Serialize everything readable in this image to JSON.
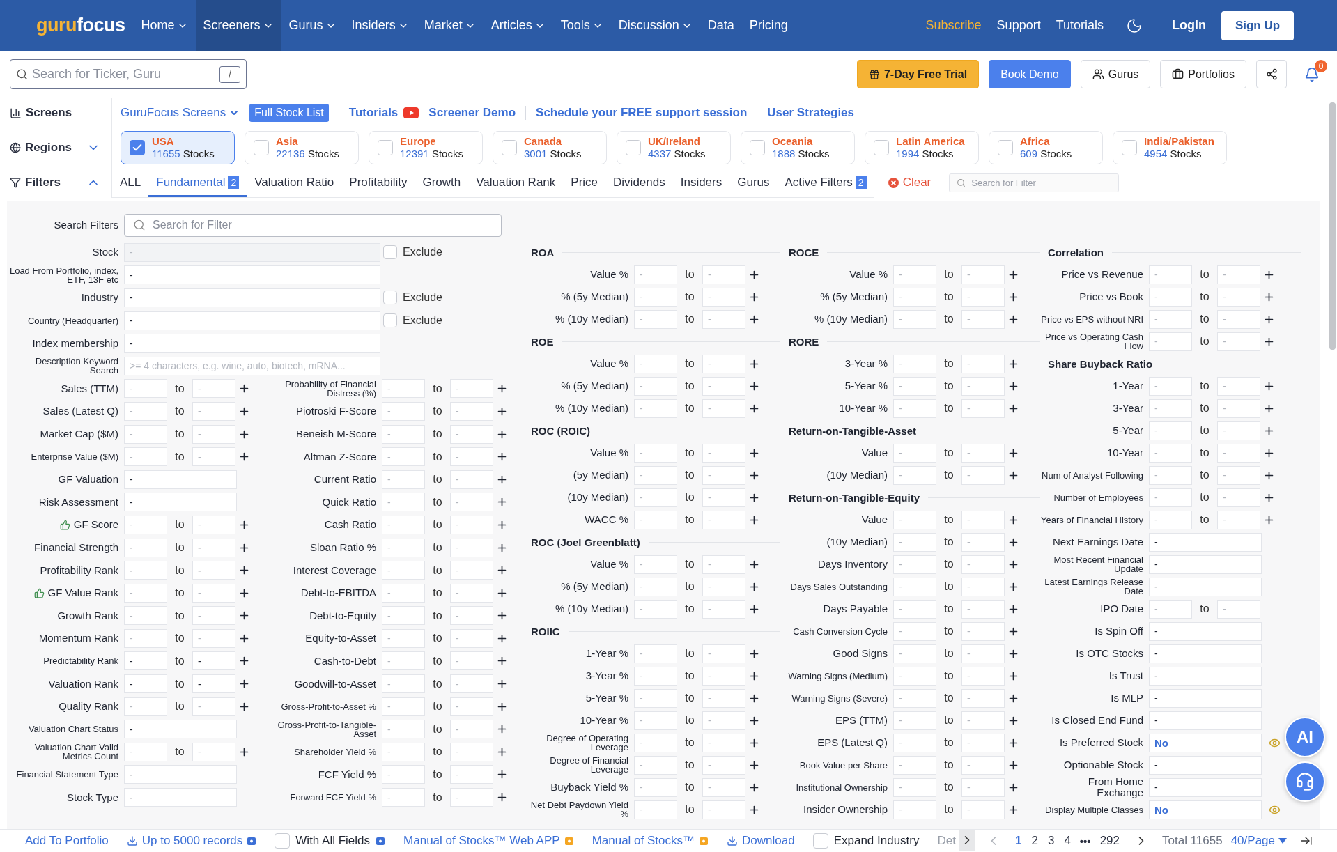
{
  "header": {
    "logo": {
      "first": "guru",
      "second": "focus"
    },
    "nav": [
      {
        "label": "Home",
        "has_menu": true,
        "selected": false
      },
      {
        "label": "Screeners",
        "has_menu": true,
        "selected": true
      },
      {
        "label": "Gurus",
        "has_menu": true,
        "selected": false
      },
      {
        "label": "Insiders",
        "has_menu": true,
        "selected": false
      },
      {
        "label": "Market",
        "has_menu": true,
        "selected": false
      },
      {
        "label": "Articles",
        "has_menu": true,
        "selected": false
      },
      {
        "label": "Tools",
        "has_menu": true,
        "selected": false
      },
      {
        "label": "Discussion",
        "has_menu": true,
        "selected": false
      },
      {
        "label": "Data",
        "has_menu": false,
        "selected": false
      },
      {
        "label": "Pricing",
        "has_menu": false,
        "selected": false
      }
    ],
    "links": [
      {
        "label": "Subscribe",
        "kind": "promo"
      },
      {
        "label": "Support",
        "kind": "plain"
      },
      {
        "label": "Tutorials",
        "kind": "plain"
      }
    ],
    "login": "Login",
    "signup": "Sign Up"
  },
  "toolbar": {
    "search": {
      "placeholder": "Search for Ticker, Guru",
      "shortcut": "/"
    },
    "buttons": [
      {
        "label": "7-Day Free Trial",
        "kind": "trial"
      },
      {
        "label": "Book Demo",
        "kind": "primary"
      },
      {
        "label": "Gurus",
        "kind": "gurus"
      },
      {
        "label": "Portfolios",
        "kind": "portfolios"
      }
    ],
    "notifications": "0"
  },
  "screens": {
    "label": "Screens",
    "dropdown": "GuruFocus Screens",
    "full_list": "Full Stock List",
    "links": [
      {
        "label": "Tutorials",
        "video": true,
        "divider_before": true
      },
      {
        "label": "Screener Demo",
        "video": false,
        "divider_before": false
      },
      {
        "label": "Schedule your FREE support session",
        "video": false,
        "divider_before": true
      },
      {
        "label": "User Strategies",
        "video": false,
        "divider_before": true
      }
    ]
  },
  "regions": {
    "label": "Regions",
    "expanded": false,
    "items": [
      {
        "name": "USA",
        "count": "11655",
        "unit": "Stocks",
        "selected": true
      },
      {
        "name": "Asia",
        "count": "22136",
        "unit": "Stocks",
        "selected": false
      },
      {
        "name": "Europe",
        "count": "12391",
        "unit": "Stocks",
        "selected": false
      },
      {
        "name": "Canada",
        "count": "3001",
        "unit": "Stocks",
        "selected": false
      },
      {
        "name": "UK/Ireland",
        "count": "4337",
        "unit": "Stocks",
        "selected": false
      },
      {
        "name": "Oceania",
        "count": "1888",
        "unit": "Stocks",
        "selected": false
      },
      {
        "name": "Latin America",
        "count": "1994",
        "unit": "Stocks",
        "selected": false
      },
      {
        "name": "Africa",
        "count": "609",
        "unit": "Stocks",
        "selected": false
      },
      {
        "name": "India/Pakistan",
        "count": "4954",
        "unit": "Stocks",
        "selected": false
      }
    ]
  },
  "filters": {
    "label": "Filters",
    "expanded": true,
    "tabs": [
      {
        "label": "ALL",
        "selected": false
      },
      {
        "label": "Fundamental",
        "selected": true,
        "count": "2"
      },
      {
        "label": "Valuation Ratio",
        "selected": false
      },
      {
        "label": "Profitability",
        "selected": false
      },
      {
        "label": "Growth",
        "selected": false
      },
      {
        "label": "Valuation Rank",
        "selected": false
      },
      {
        "label": "Price",
        "selected": false
      },
      {
        "label": "Dividends",
        "selected": false
      },
      {
        "label": "Insiders",
        "selected": false
      },
      {
        "label": "Gurus",
        "selected": false
      },
      {
        "label": "Active Filters",
        "selected": false,
        "count": "2"
      }
    ],
    "clear": "Clear",
    "search_placeholder": "Search for Filter"
  },
  "panel": {
    "search_label": "Search Filters",
    "search_placeholder": "Search for Filter",
    "top_rows": [
      {
        "label": "Stock",
        "placeholder": "-",
        "disabled": true,
        "exclude": "Exclude",
        "excluded": false
      },
      {
        "label": "Load From Portfolio, index, ETF, 13F etc",
        "value": "-",
        "disabled": false
      },
      {
        "label": "Industry",
        "value": "-",
        "disabled": false,
        "exclude": "Exclude",
        "excluded": false
      },
      {
        "label": "Country (Headquarter)",
        "value": "-",
        "disabled": false,
        "exclude": "Exclude",
        "excluded": false
      },
      {
        "label": "Index membership",
        "value": "-",
        "disabled": false
      },
      {
        "label": "Description Keyword Search",
        "placeholder": ">= 4 characters, e.g. wine, auto, biotech, mRNA...",
        "disabled": false
      }
    ],
    "left": [
      {
        "kind": "range",
        "label": "Sales (TTM)",
        "min": "-",
        "sep": "to",
        "max": "-"
      },
      {
        "kind": "range",
        "label": "Sales (Latest Q)",
        "min": "-",
        "sep": "to",
        "max": "-"
      },
      {
        "kind": "range",
        "label": "Market Cap ($M)",
        "min": "-",
        "sep": "to",
        "max": "-"
      },
      {
        "kind": "range",
        "label": "Enterprise Value ($M)",
        "min": "-",
        "sep": "to",
        "max": "-"
      },
      {
        "kind": "select",
        "label": "GF Valuation",
        "value": "-"
      },
      {
        "kind": "select",
        "label": "Risk Assessment",
        "value": "-"
      },
      {
        "kind": "range",
        "label": "GF Score",
        "min": "-",
        "sep": "to",
        "max": "-",
        "thumb": true
      },
      {
        "kind": "rank_range",
        "label": "Financial Strength",
        "min": "-",
        "sep": "to",
        "max": "-"
      },
      {
        "kind": "rank_range",
        "label": "Profitability Rank",
        "min": "-",
        "sep": "to",
        "max": "-"
      },
      {
        "kind": "range",
        "label": "GF Value Rank",
        "min": "-",
        "sep": "to",
        "max": "-",
        "thumb": true
      },
      {
        "kind": "range",
        "label": "Growth Rank",
        "min": "-",
        "sep": "to",
        "max": "-"
      },
      {
        "kind": "range",
        "label": "Momentum Rank",
        "min": "-",
        "sep": "to",
        "max": "-"
      },
      {
        "kind": "rank_range",
        "label": "Predictability Rank",
        "min": "-",
        "sep": "to",
        "max": "-"
      },
      {
        "kind": "rank_range",
        "label": "Valuation Rank",
        "min": "-",
        "sep": "to",
        "max": "-"
      },
      {
        "kind": "range",
        "label": "Quality Rank",
        "min": "-",
        "sep": "to",
        "max": "-"
      },
      {
        "kind": "select",
        "label": "Valuation Chart Status",
        "value": "-"
      },
      {
        "kind": "range",
        "label": "Valuation Chart Valid Metrics Count",
        "min": "-",
        "sep": "to",
        "max": "-"
      },
      {
        "kind": "select",
        "label": "Financial Statement Type",
        "value": "-"
      },
      {
        "kind": "select",
        "label": "Stock Type",
        "value": "-"
      }
    ],
    "right": [
      {
        "kind": "range",
        "label": "Probability of Financial Distress (%)",
        "min": "-",
        "sep": "to",
        "max": "-"
      },
      {
        "kind": "range",
        "label": "Piotroski F-Score",
        "min": "-",
        "sep": "to",
        "max": "-"
      },
      {
        "kind": "range",
        "label": "Beneish M-Score",
        "min": "-",
        "sep": "to",
        "max": "-"
      },
      {
        "kind": "range",
        "label": "Altman Z-Score",
        "min": "-",
        "sep": "to",
        "max": "-"
      },
      {
        "kind": "range",
        "label": "Current Ratio",
        "min": "-",
        "sep": "to",
        "max": "-"
      },
      {
        "kind": "range",
        "label": "Quick Ratio",
        "min": "-",
        "sep": "to",
        "max": "-"
      },
      {
        "kind": "range",
        "label": "Cash Ratio",
        "min": "-",
        "sep": "to",
        "max": "-"
      },
      {
        "kind": "range",
        "label": "Sloan Ratio %",
        "min": "-",
        "sep": "to",
        "max": "-"
      },
      {
        "kind": "range",
        "label": "Interest Coverage",
        "min": "-",
        "sep": "to",
        "max": "-"
      },
      {
        "kind": "range",
        "label": "Debt-to-EBITDA",
        "min": "-",
        "sep": "to",
        "max": "-"
      },
      {
        "kind": "range",
        "label": "Debt-to-Equity",
        "min": "-",
        "sep": "to",
        "max": "-"
      },
      {
        "kind": "range",
        "label": "Equity-to-Asset",
        "min": "-",
        "sep": "to",
        "max": "-"
      },
      {
        "kind": "range",
        "label": "Cash-to-Debt",
        "min": "-",
        "sep": "to",
        "max": "-"
      },
      {
        "kind": "range",
        "label": "Goodwill-to-Asset",
        "min": "-",
        "sep": "to",
        "max": "-"
      },
      {
        "kind": "range",
        "label": "Gross-Profit-to-Asset %",
        "min": "-",
        "sep": "to",
        "max": "-"
      },
      {
        "kind": "range",
        "label": "Gross-Profit-to-Tangible-Asset",
        "min": "-",
        "sep": "to",
        "max": "-"
      },
      {
        "kind": "range",
        "label": "Shareholder Yield %",
        "min": "-",
        "sep": "to",
        "max": "-"
      },
      {
        "kind": "range",
        "label": "FCF Yield %",
        "min": "-",
        "sep": "to",
        "max": "-"
      },
      {
        "kind": "range",
        "label": "Forward FCF Yield %",
        "min": "-",
        "sep": "to",
        "max": "-"
      }
    ],
    "columns": [
      [
        {
          "heading": "ROA",
          "rows": [
            {
              "kind": "range",
              "label": "Value %",
              "min": "-",
              "sep": "to",
              "max": "-"
            },
            {
              "kind": "range",
              "label": "% (5y Median)",
              "min": "-",
              "sep": "to",
              "max": "-"
            },
            {
              "kind": "range",
              "label": "% (10y Median)",
              "min": "-",
              "sep": "to",
              "max": "-"
            }
          ]
        },
        {
          "heading": "ROE",
          "rows": [
            {
              "kind": "range",
              "label": "Value %",
              "min": "-",
              "sep": "to",
              "max": "-"
            },
            {
              "kind": "range",
              "label": "% (5y Median)",
              "min": "-",
              "sep": "to",
              "max": "-"
            },
            {
              "kind": "range",
              "label": "% (10y Median)",
              "min": "-",
              "sep": "to",
              "max": "-"
            }
          ]
        },
        {
          "heading": "ROC (ROIC)",
          "rows": [
            {
              "kind": "range",
              "label": "Value %",
              "min": "-",
              "sep": "to",
              "max": "-"
            },
            {
              "kind": "range",
              "label": "(5y Median)",
              "min": "-",
              "sep": "to",
              "max": "-"
            },
            {
              "kind": "range",
              "label": "(10y Median)",
              "min": "-",
              "sep": "to",
              "max": "-"
            },
            {
              "kind": "range",
              "label": "WACC %",
              "min": "-",
              "sep": "to",
              "max": "-"
            }
          ]
        },
        {
          "heading": "ROC (Joel Greenblatt)",
          "rows": [
            {
              "kind": "range",
              "label": "Value %",
              "min": "-",
              "sep": "to",
              "max": "-"
            },
            {
              "kind": "range",
              "label": "% (5y Median)",
              "min": "-",
              "sep": "to",
              "max": "-"
            },
            {
              "kind": "range",
              "label": "% (10y Median)",
              "min": "-",
              "sep": "to",
              "max": "-"
            }
          ]
        },
        {
          "heading": "ROIIC",
          "rows": [
            {
              "kind": "range",
              "label": "1-Year %",
              "min": "-",
              "sep": "to",
              "max": "-"
            },
            {
              "kind": "range",
              "label": "3-Year %",
              "min": "-",
              "sep": "to",
              "max": "-"
            },
            {
              "kind": "range",
              "label": "5-Year %",
              "min": "-",
              "sep": "to",
              "max": "-"
            },
            {
              "kind": "range",
              "label": "10-Year %",
              "min": "-",
              "sep": "to",
              "max": "-"
            },
            {
              "kind": "range",
              "label": "Degree of Operating Leverage",
              "min": "-",
              "sep": "to",
              "max": "-"
            },
            {
              "kind": "range",
              "label": "Degree of Financial Leverage",
              "min": "-",
              "sep": "to",
              "max": "-"
            },
            {
              "kind": "range",
              "label": "Buyback Yield %",
              "min": "-",
              "sep": "to",
              "max": "-"
            },
            {
              "kind": "range",
              "label": "Net Debt Paydown Yield %",
              "min": "-",
              "sep": "to",
              "max": "-"
            }
          ]
        }
      ],
      [
        {
          "heading": "ROCE",
          "rows": [
            {
              "kind": "range",
              "label": "Value %",
              "min": "-",
              "sep": "to",
              "max": "-"
            },
            {
              "kind": "range",
              "label": "% (5y Median)",
              "min": "-",
              "sep": "to",
              "max": "-"
            },
            {
              "kind": "range",
              "label": "% (10y Median)",
              "min": "-",
              "sep": "to",
              "max": "-"
            }
          ]
        },
        {
          "heading": "RORE",
          "rows": [
            {
              "kind": "range",
              "label": "3-Year %",
              "min": "-",
              "sep": "to",
              "max": "-"
            },
            {
              "kind": "range",
              "label": "5-Year %",
              "min": "-",
              "sep": "to",
              "max": "-"
            },
            {
              "kind": "range",
              "label": "10-Year %",
              "min": "-",
              "sep": "to",
              "max": "-"
            }
          ]
        },
        {
          "heading": "Return-on-Tangible-Asset",
          "rows": [
            {
              "kind": "range",
              "label": "Value",
              "min": "-",
              "sep": "to",
              "max": "-"
            },
            {
              "kind": "range",
              "label": "(10y Median)",
              "min": "-",
              "sep": "to",
              "max": "-"
            }
          ]
        },
        {
          "heading": "Return-on-Tangible-Equity",
          "rows": [
            {
              "kind": "range",
              "label": "Value",
              "min": "-",
              "sep": "to",
              "max": "-"
            },
            {
              "kind": "range",
              "label": "(10y Median)",
              "min": "-",
              "sep": "to",
              "max": "-"
            },
            {
              "kind": "range",
              "label": "Days Inventory",
              "min": "-",
              "sep": "to",
              "max": "-"
            },
            {
              "kind": "range",
              "label": "Days Sales Outstanding",
              "min": "-",
              "sep": "to",
              "max": "-"
            },
            {
              "kind": "range",
              "label": "Days Payable",
              "min": "-",
              "sep": "to",
              "max": "-"
            },
            {
              "kind": "range",
              "label": "Cash Conversion Cycle",
              "min": "-",
              "sep": "to",
              "max": "-"
            },
            {
              "kind": "range",
              "label": "Good Signs",
              "min": "-",
              "sep": "to",
              "max": "-"
            },
            {
              "kind": "range",
              "label": "Warning Signs (Medium)",
              "min": "-",
              "sep": "to",
              "max": "-"
            },
            {
              "kind": "range",
              "label": "Warning Signs (Severe)",
              "min": "-",
              "sep": "to",
              "max": "-"
            },
            {
              "kind": "range",
              "label": "EPS (TTM)",
              "min": "-",
              "sep": "to",
              "max": "-"
            },
            {
              "kind": "range",
              "label": "EPS (Latest Q)",
              "min": "-",
              "sep": "to",
              "max": "-"
            },
            {
              "kind": "range",
              "label": "Book Value per Share",
              "min": "-",
              "sep": "to",
              "max": "-"
            },
            {
              "kind": "range",
              "label": "Institutional Ownership",
              "min": "-",
              "sep": "to",
              "max": "-"
            },
            {
              "kind": "range",
              "label": "Insider Ownership",
              "min": "-",
              "sep": "to",
              "max": "-"
            }
          ]
        }
      ],
      [
        {
          "heading": "Correlation",
          "rows": [
            {
              "kind": "range",
              "label": "Price vs Revenue",
              "min": "-",
              "sep": "to",
              "max": "-"
            },
            {
              "kind": "range",
              "label": "Price vs Book",
              "min": "-",
              "sep": "to",
              "max": "-"
            },
            {
              "kind": "range",
              "label": "Price vs EPS without NRI",
              "min": "-",
              "sep": "to",
              "max": "-"
            },
            {
              "kind": "range",
              "label": "Price vs Operating Cash Flow",
              "min": "-",
              "sep": "to",
              "max": "-"
            }
          ]
        },
        {
          "heading": "Share Buyback Ratio",
          "rows": [
            {
              "kind": "range",
              "label": "1-Year",
              "min": "-",
              "sep": "to",
              "max": "-"
            },
            {
              "kind": "range",
              "label": "3-Year",
              "min": "-",
              "sep": "to",
              "max": "-"
            },
            {
              "kind": "range",
              "label": "5-Year",
              "min": "-",
              "sep": "to",
              "max": "-"
            },
            {
              "kind": "range",
              "label": "10-Year",
              "min": "-",
              "sep": "to",
              "max": "-"
            },
            {
              "kind": "range",
              "label": "Num of Analyst Following",
              "min": "-",
              "sep": "to",
              "max": "-"
            },
            {
              "kind": "range",
              "label": "Number of Employees",
              "min": "-",
              "sep": "to",
              "max": "-"
            },
            {
              "kind": "range",
              "label": "Years of Financial History",
              "min": "-",
              "sep": "to",
              "max": "-"
            },
            {
              "kind": "select",
              "label": "Next Earnings Date",
              "value": "-"
            },
            {
              "kind": "select",
              "label": "Most Recent Financial Update",
              "value": "-"
            },
            {
              "kind": "select",
              "label": "Latest Earnings Release Date",
              "value": "-"
            },
            {
              "kind": "date_range",
              "label": "IPO Date",
              "min": "-",
              "sep": "to",
              "max": "-"
            },
            {
              "kind": "select",
              "label": "Is Spin Off",
              "value": "-"
            },
            {
              "kind": "select",
              "label": "Is OTC Stocks",
              "value": "-"
            },
            {
              "kind": "select",
              "label": "Is Trust",
              "value": "-"
            },
            {
              "kind": "select",
              "label": "Is MLP",
              "value": "-"
            },
            {
              "kind": "select",
              "label": "Is Closed End Fund",
              "value": "-"
            },
            {
              "kind": "select",
              "label": "Is Preferred Stock",
              "value": "No",
              "active": true
            },
            {
              "kind": "select",
              "label": "Optionable Stock",
              "value": "-"
            },
            {
              "kind": "select",
              "label": "From Home Exchange",
              "value": "-"
            },
            {
              "kind": "select",
              "label": "Display Multiple Classes",
              "value": "No",
              "active": true
            }
          ]
        }
      ]
    ]
  },
  "bottom_bar": {
    "actions": [
      {
        "label": "Add To Portfolio",
        "kind": "link"
      },
      {
        "label": "Up to 5000 records",
        "kind": "download",
        "color": "#3b6fd6"
      },
      {
        "label": "With All Fields",
        "kind": "checkbox",
        "checked": false,
        "color": "#3b6fd6"
      },
      {
        "label": "Manual of Stocks™ Web APP",
        "kind": "link",
        "color": "#f5a623"
      },
      {
        "label": "Manual of Stocks™",
        "kind": "link",
        "color": "#f5a623"
      },
      {
        "label": "Download",
        "kind": "download"
      },
      {
        "label": "Expand Industry",
        "kind": "checkbox",
        "checked": false
      },
      {
        "label": "Det",
        "kind": "cut"
      }
    ],
    "pagination": {
      "pages": [
        {
          "kind": "page",
          "label": "1",
          "selected": true
        },
        {
          "kind": "page",
          "label": "2",
          "selected": false
        },
        {
          "kind": "page",
          "label": "3",
          "selected": false
        },
        {
          "kind": "page",
          "label": "4",
          "selected": false
        },
        {
          "kind": "ellipsis",
          "label": "•••"
        },
        {
          "kind": "page",
          "label": "292",
          "selected": false
        }
      ],
      "total": "Total 11655",
      "per_page": "40/Page"
    }
  },
  "assistant": {
    "label": "AI"
  }
}
